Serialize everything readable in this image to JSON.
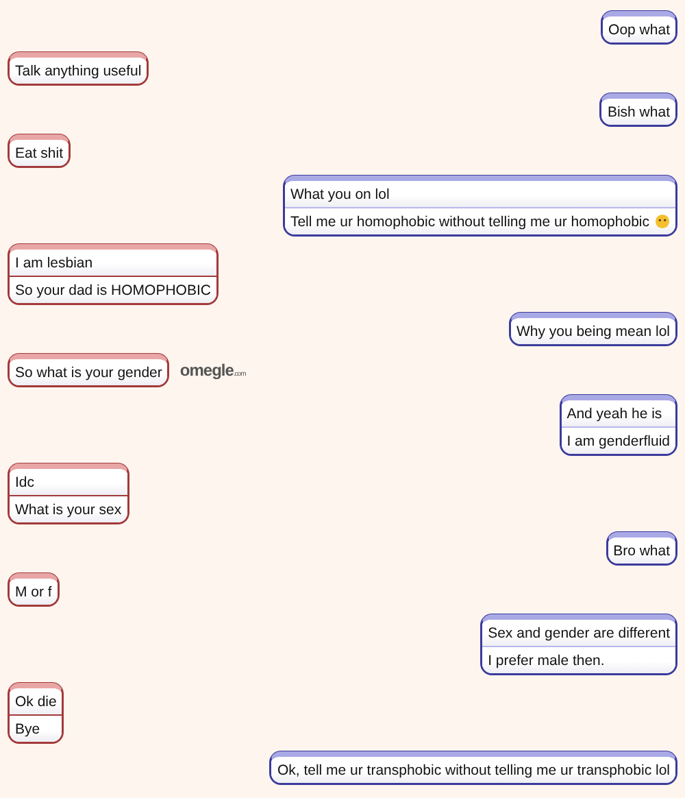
{
  "messages": [
    {
      "outgoing": true,
      "lines": [
        {
          "text": "Oop what"
        }
      ]
    },
    {
      "outgoing": false,
      "lines": [
        {
          "text": "Talk anything useful"
        }
      ]
    },
    {
      "outgoing": true,
      "lines": [
        {
          "text": "Bish what"
        }
      ]
    },
    {
      "outgoing": false,
      "lines": [
        {
          "text": "Eat shit"
        }
      ]
    },
    {
      "outgoing": true,
      "lines": [
        {
          "text": "What you on lol"
        },
        {
          "text": "Tell me ur homophobic without telling me ur homophobic",
          "emoji": true
        }
      ]
    },
    {
      "outgoing": false,
      "lines": [
        {
          "text": "I am lesbian"
        },
        {
          "text": "So your dad is HOMOPHOBIC"
        }
      ]
    },
    {
      "outgoing": true,
      "lines": [
        {
          "text": "Why you being mean lol"
        }
      ]
    },
    {
      "outgoing": false,
      "lines": [
        {
          "text": "So what is your gender"
        }
      ],
      "logo": {
        "name": "omegle",
        "suffix": ".com"
      }
    },
    {
      "outgoing": true,
      "lines": [
        {
          "text": "And yeah he is"
        },
        {
          "text": "I am genderfluid"
        }
      ]
    },
    {
      "outgoing": false,
      "lines": [
        {
          "text": "Idc"
        },
        {
          "text": "What is your sex"
        }
      ]
    },
    {
      "outgoing": true,
      "lines": [
        {
          "text": "Bro what"
        }
      ]
    },
    {
      "outgoing": false,
      "lines": [
        {
          "text": "M or f"
        }
      ]
    },
    {
      "outgoing": true,
      "lines": [
        {
          "text": "Sex and gender are different"
        },
        {
          "text": "I prefer male then."
        }
      ]
    },
    {
      "outgoing": false,
      "lines": [
        {
          "text": "Ok die"
        },
        {
          "text": "Bye"
        }
      ]
    },
    {
      "outgoing": true,
      "lines": [
        {
          "text": "Ok, tell me ur transphobic without telling me ur transphobic lol"
        }
      ]
    }
  ]
}
